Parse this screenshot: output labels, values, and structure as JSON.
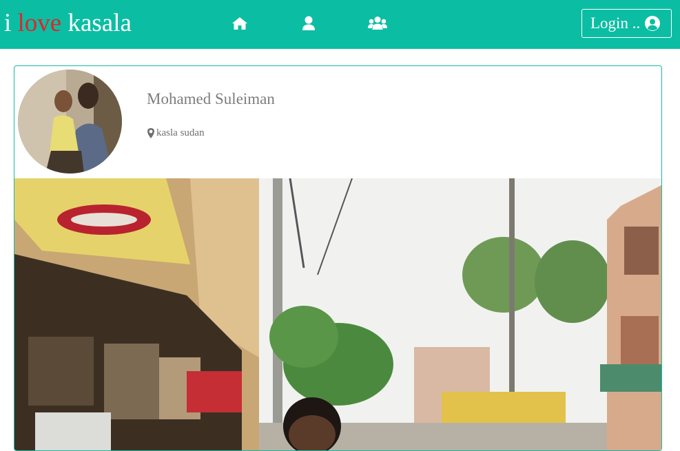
{
  "brand": {
    "prefix": "i",
    "accent": "love",
    "suffix": "kasala"
  },
  "nav": {
    "icons": [
      "home-icon",
      "user-icon",
      "users-group-icon"
    ]
  },
  "login": {
    "label": "Login ..",
    "icon": "user-circle-icon"
  },
  "profile": {
    "name": "Mohamed Suleiman",
    "location": "kasla sudan",
    "location_icon": "map-marker-icon"
  },
  "colors": {
    "navbar": "#0bbea3",
    "brand_accent": "#e0252a",
    "card_border": "#18b9a3",
    "text_muted": "#7d7d7d"
  }
}
